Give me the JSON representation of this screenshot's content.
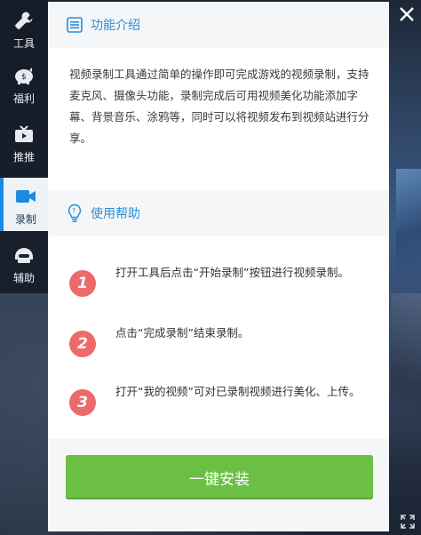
{
  "sidebar": {
    "items": [
      {
        "label": "工具",
        "icon": "wrench-icon"
      },
      {
        "label": "福利",
        "icon": "piggy-bank-icon"
      },
      {
        "label": "推推",
        "icon": "tv-icon"
      },
      {
        "label": "录制",
        "icon": "video-camera-icon",
        "active": true
      },
      {
        "label": "辅助",
        "icon": "helmet-icon"
      }
    ]
  },
  "intro": {
    "title": "功能介绍",
    "body": "视频录制工具通过简单的操作即可完成游戏的视频录制，支持麦克风、摄像头功能，录制完成后可用视频美化功能添加字幕、背景音乐、涂鸦等，同时可以将视频发布到视频站进行分享。"
  },
  "help": {
    "title": "使用帮助",
    "steps": [
      {
        "num": "1",
        "text": "打开工具后点击“开始录制”按钮进行视频录制。"
      },
      {
        "num": "2",
        "text": "点击“完成录制”结束录制。"
      },
      {
        "num": "3",
        "text": "打开“我的视频”可对已录制视频进行美化、上传。"
      }
    ]
  },
  "actions": {
    "install_label": "一键安装"
  },
  "colors": {
    "accent": "#2a8fd6",
    "install_button": "#6cbf45",
    "step_badge": "#ec6a6a"
  }
}
